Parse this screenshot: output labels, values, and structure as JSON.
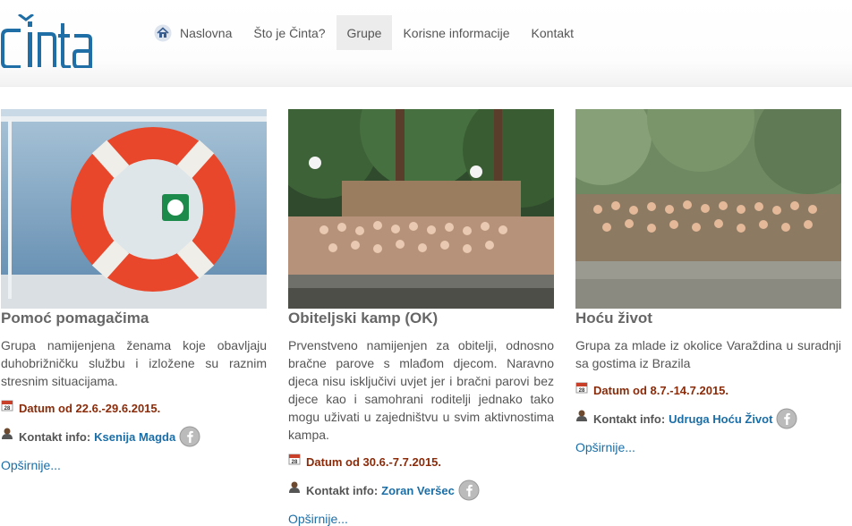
{
  "header": {
    "logo_text": "Činta",
    "nav": [
      {
        "label": "Naslovna",
        "icon": "home-icon"
      },
      {
        "label": "Što je Činta?"
      },
      {
        "label": "Grupe",
        "active": true
      },
      {
        "label": "Korisne informacije"
      },
      {
        "label": "Kontakt"
      }
    ]
  },
  "groups": [
    {
      "title": "Pomoć pomagačima",
      "description": "Grupa namijenjena ženama koje obavljaju duhobrižničku službu i izložene su raznim stresnim situacijama.",
      "date": "Datum od 22.6.-29.6.2015.",
      "contact_label": "Kontakt info:",
      "contact_name": "Ksenija Magda",
      "more": "Opširnije..."
    },
    {
      "title": "Obiteljski kamp (OK)",
      "description": "Prvenstveno namijenjen za obitelji, odnosno bračne parove s mlađom djecom. Naravno djeca nisu isključivi uvjet jer i bračni parovi bez djece kao i samohrani roditelji jednako tako mogu uživati u zajedništvu u svim aktivnostima kampa.",
      "date": "Datum od 30.6.-7.7.2015.",
      "contact_label": "Kontakt info:",
      "contact_name": "Zoran Veršec",
      "more": "Opširnije..."
    },
    {
      "title": "Hoću život",
      "description": "Grupa za mlade iz okolice Varaždina u suradnji sa gostima iz Brazila",
      "date": "Datum od 8.7.-14.7.2015.",
      "contact_label": "Kontakt info:",
      "contact_name": "Udruga Hoću Život",
      "more": "Opširnije..."
    }
  ],
  "colors": {
    "link": "#1a6ea8",
    "date": "#8a2b0a",
    "logo": "#1f6fa6"
  }
}
